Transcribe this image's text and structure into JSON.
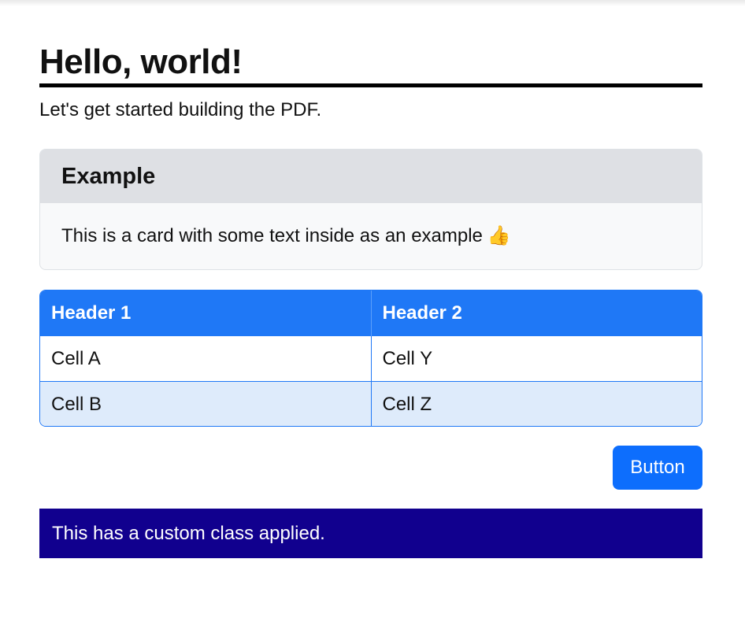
{
  "heading": {
    "title": "Hello, world!",
    "lead": "Let's get started building the PDF."
  },
  "card": {
    "header": "Example",
    "body": "This is a card with some text inside as an example",
    "icon": "thumbs-up-icon",
    "icon_glyph": "👍"
  },
  "table": {
    "headers": [
      "Header 1",
      "Header 2"
    ],
    "rows": [
      [
        "Cell A",
        "Cell Y"
      ],
      [
        "Cell B",
        "Cell Z"
      ]
    ]
  },
  "button": {
    "label": "Button"
  },
  "custom": {
    "text": "This has a custom class applied."
  },
  "colors": {
    "primary": "#0d6efd",
    "table_header": "#1f78f6",
    "custom_box": "#11008e",
    "card_header": "#dee0e4"
  }
}
